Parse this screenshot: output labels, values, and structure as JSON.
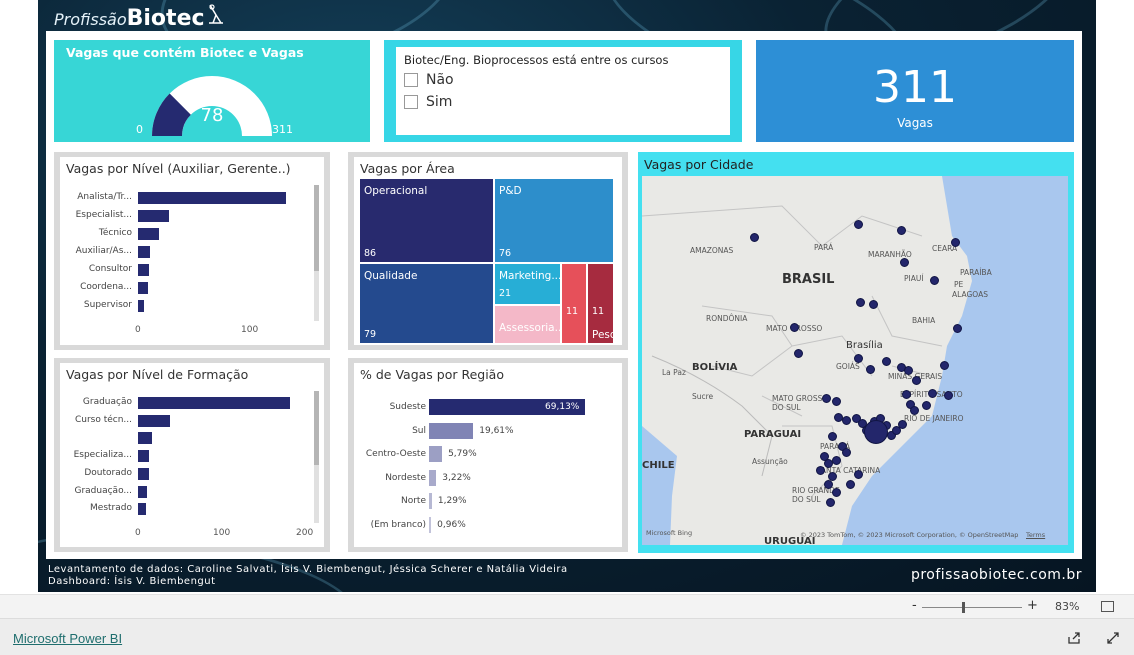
{
  "logo": {
    "prefix": "Profissão",
    "brand": "Biotec"
  },
  "gauge": {
    "title": "Vagas que contém Biotec e Vagas",
    "value": "78",
    "min": "0",
    "max": "311",
    "fraction": 0.2508,
    "fill_color": "#252a70",
    "track_color": "#ffffff"
  },
  "slicer": {
    "title": "Biotec/Eng. Bioprocessos está entre os cursos",
    "options": [
      "Não",
      "Sim"
    ]
  },
  "kpi": {
    "value": "311",
    "label": "Vagas"
  },
  "nivel": {
    "title": "Vagas por Nível (Auxiliar, Gerente..)",
    "ticks": [
      "0",
      "100"
    ]
  },
  "formacao": {
    "title": "Vagas por Nível de Formação",
    "ticks": [
      "0",
      "100",
      "200"
    ]
  },
  "area": {
    "title": "Vagas por Área"
  },
  "regiao": {
    "title": "% de Vagas por Região"
  },
  "map": {
    "title": "Vagas por Cidade",
    "labels": {
      "brasil": "BRASIL",
      "brasilia": "Brasília",
      "bolivia": "BOLÍVIA",
      "paraguai": "PARAGUAI",
      "chile": "CHILE",
      "uruguai": "URUGUAI",
      "amazonas": "AMAZONAS",
      "para": "PARÁ",
      "maranhao": "MARANHÃO",
      "ceara": "CEARÁ",
      "piaui": "PIAUÍ",
      "paraiba": "PARAÍBA",
      "pe": "PE",
      "alagoas": "ALAGOAS",
      "bahia": "BAHIA",
      "rondonia": "RONDÔNIA",
      "mato_grosso": "MATO GROSSO",
      "goias": "GOIÁS",
      "minas": "MINAS GERAIS",
      "espirito_santo": "ESPÍRITO SANTO",
      "rio": "RIO DE JANEIRO",
      "msul": "MATO GROSSO DO SUL",
      "parana": "PARANÁ",
      "santa_catarina": "SANTA CATARINA",
      "rs": "RIO GRANDE DO SUL",
      "la_paz": "La Paz",
      "sucre": "Sucre",
      "assuncao": "Assunção",
      "copyright": "© 2023 TomTom, © 2023 Microsoft Corporation, © OpenStreetMap",
      "terms": "Terms",
      "bing": "Microsoft Bing"
    }
  },
  "chart_data": [
    {
      "type": "bar",
      "title": "Vagas por Nível (Auxiliar, Gerente..)",
      "categories": [
        "Analista/Tr...",
        "Especialist...",
        "Técnico",
        "Auxiliar/As...",
        "Consultor",
        "Coordena...",
        "Supervisor"
      ],
      "values": [
        131,
        27,
        19,
        11,
        10,
        9,
        5
      ],
      "xlim": [
        0,
        160
      ]
    },
    {
      "type": "bar",
      "title": "Vagas por Nível de Formação",
      "categories": [
        "Graduação",
        "Curso técn...",
        "",
        "Especializa...",
        "Doutorado",
        "Graduação...",
        "Mestrado"
      ],
      "values": [
        184,
        39,
        17,
        13,
        13,
        11,
        10
      ],
      "xlim": [
        0,
        210
      ]
    },
    {
      "type": "heatmap",
      "title": "Vagas por Área",
      "categories": [
        "Operacional",
        "P&D",
        "Qualidade",
        "Marketing...",
        "Assessoria...",
        "",
        "Pesqui..."
      ],
      "values": [
        86,
        76,
        79,
        21,
        null,
        11,
        11
      ],
      "colors": [
        "#282a6e",
        "#2d8ecb",
        "#244a8e",
        "#27aed6",
        "#f4b8c8",
        "#e6505a",
        "#a62b3f"
      ]
    },
    {
      "type": "bar",
      "title": "% de Vagas por Região",
      "categories": [
        "Sudeste",
        "Sul",
        "Centro-Oeste",
        "Nordeste",
        "Norte",
        "(Em branco)"
      ],
      "values": [
        69.13,
        19.61,
        5.79,
        3.22,
        1.29,
        0.96
      ],
      "labels": [
        "69,13%",
        "19,61%",
        "5,79%",
        "3,22%",
        "1,29%",
        "0,96%"
      ],
      "xlim": [
        0,
        70
      ]
    }
  ],
  "footer": {
    "credits_line1": "Levantamento de dados: Caroline Salvati, Ísis V. Biembengut, Jéssica Scherer e Natália Videira",
    "credits_line2": "Dashboard: Ísis V. Biembengut",
    "site": "profissaobiotec.com.br"
  },
  "zoom": {
    "minus": "-",
    "plus": "+",
    "level": "83%",
    "fraction": 0.4
  },
  "bottom": {
    "link": "Microsoft Power BI"
  }
}
